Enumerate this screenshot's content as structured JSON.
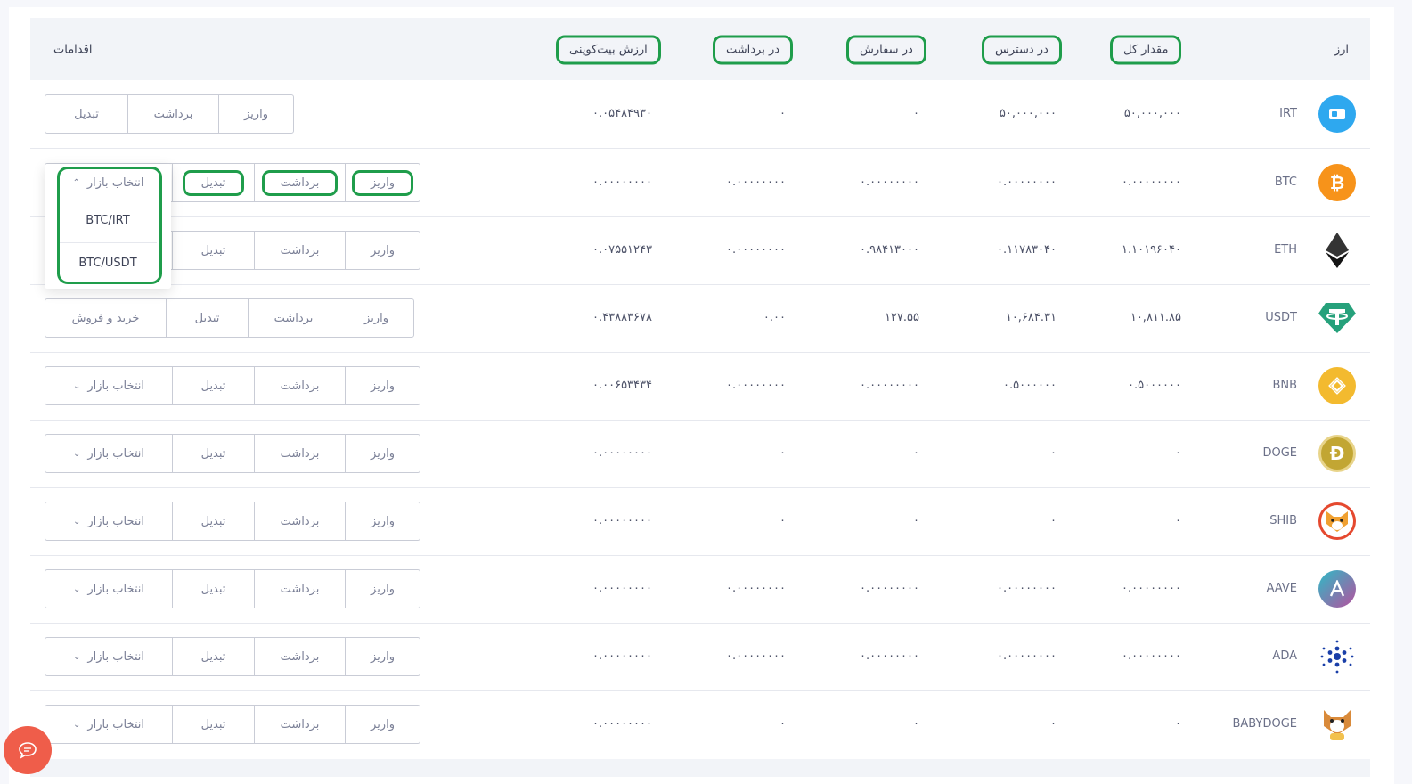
{
  "header": {
    "currency": "ارز",
    "total": "مقدار کل",
    "available": "در دسترس",
    "in_order": "در سفارش",
    "in_withdraw": "در برداشت",
    "btc_value": "ارزش بیت‌کوینی",
    "actions": "اقدامات"
  },
  "actions": {
    "deposit": "واریز",
    "withdraw": "برداشت",
    "convert": "تبدیل",
    "market": "انتخاب بازار",
    "buy_sell": "خرید و فروش"
  },
  "dropdown": {
    "items": [
      "BTC/IRT",
      "BTC/USDT"
    ]
  },
  "rows": [
    {
      "symbol": "IRT",
      "total": "۵۰,۰۰۰,۰۰۰",
      "available": "۵۰,۰۰۰,۰۰۰",
      "in_order": "۰",
      "in_withdraw": "۰",
      "btc_value": "۰.۰۵۴۸۴۹۳۰",
      "icon": "irt-icon",
      "color": "#2ea8ef"
    },
    {
      "symbol": "BTC",
      "total": "۰.۰۰۰۰۰۰۰۰",
      "available": "۰.۰۰۰۰۰۰۰۰",
      "in_order": "۰.۰۰۰۰۰۰۰۰",
      "in_withdraw": "۰.۰۰۰۰۰۰۰۰",
      "btc_value": "۰.۰۰۰۰۰۰۰۰",
      "icon": "bitcoin-icon",
      "color": "#f7931a"
    },
    {
      "symbol": "ETH",
      "total": "۱.۱۰۱۹۶۰۴۰",
      "available": "۰.۱۱۷۸۳۰۴۰",
      "in_order": "۰.۹۸۴۱۳۰۰۰",
      "in_withdraw": "۰.۰۰۰۰۰۰۰۰",
      "btc_value": "۰.۰۷۵۵۱۲۴۳",
      "icon": "ethereum-icon",
      "color": "#2a2a2a"
    },
    {
      "symbol": "USDT",
      "total": "۱۰,۸۱۱.۸۵",
      "available": "۱۰,۶۸۴.۳۱",
      "in_order": "۱۲۷.۵۵",
      "in_withdraw": "۰.۰۰",
      "btc_value": "۰.۴۳۸۸۳۶۷۸",
      "icon": "tether-icon",
      "color": "#26a17b"
    },
    {
      "symbol": "BNB",
      "total": "۰.۵۰۰۰۰۰۰",
      "available": "۰.۵۰۰۰۰۰۰",
      "in_order": "۰.۰۰۰۰۰۰۰۰",
      "in_withdraw": "۰.۰۰۰۰۰۰۰۰",
      "btc_value": "۰.۰۰۶۵۳۴۳۴",
      "icon": "bnb-icon",
      "color": "#f3ba2f"
    },
    {
      "symbol": "DOGE",
      "total": "۰",
      "available": "۰",
      "in_order": "۰",
      "in_withdraw": "۰",
      "btc_value": "۰.۰۰۰۰۰۰۰۰",
      "icon": "dogecoin-icon",
      "color": "#c2a633"
    },
    {
      "symbol": "SHIB",
      "total": "۰",
      "available": "۰",
      "in_order": "۰",
      "in_withdraw": "۰",
      "btc_value": "۰.۰۰۰۰۰۰۰۰",
      "icon": "shiba-icon",
      "color": "#e5492f"
    },
    {
      "symbol": "AAVE",
      "total": "۰.۰۰۰۰۰۰۰۰",
      "available": "۰.۰۰۰۰۰۰۰۰",
      "in_order": "۰.۰۰۰۰۰۰۰۰",
      "in_withdraw": "۰.۰۰۰۰۰۰۰۰",
      "btc_value": "۰.۰۰۰۰۰۰۰۰",
      "icon": "aave-icon",
      "color": "#7b5fb8"
    },
    {
      "symbol": "ADA",
      "total": "۰.۰۰۰۰۰۰۰۰",
      "available": "۰.۰۰۰۰۰۰۰۰",
      "in_order": "۰.۰۰۰۰۰۰۰۰",
      "in_withdraw": "۰.۰۰۰۰۰۰۰۰",
      "btc_value": "۰.۰۰۰۰۰۰۰۰",
      "icon": "cardano-icon",
      "color": "#1a3fa8"
    },
    {
      "symbol": "BABYDOGE",
      "total": "۰",
      "available": "۰",
      "in_order": "۰",
      "in_withdraw": "۰",
      "btc_value": "۰.۰۰۰۰۰۰۰۰",
      "icon": "babydoge-icon",
      "color": "#d98a3a"
    }
  ]
}
